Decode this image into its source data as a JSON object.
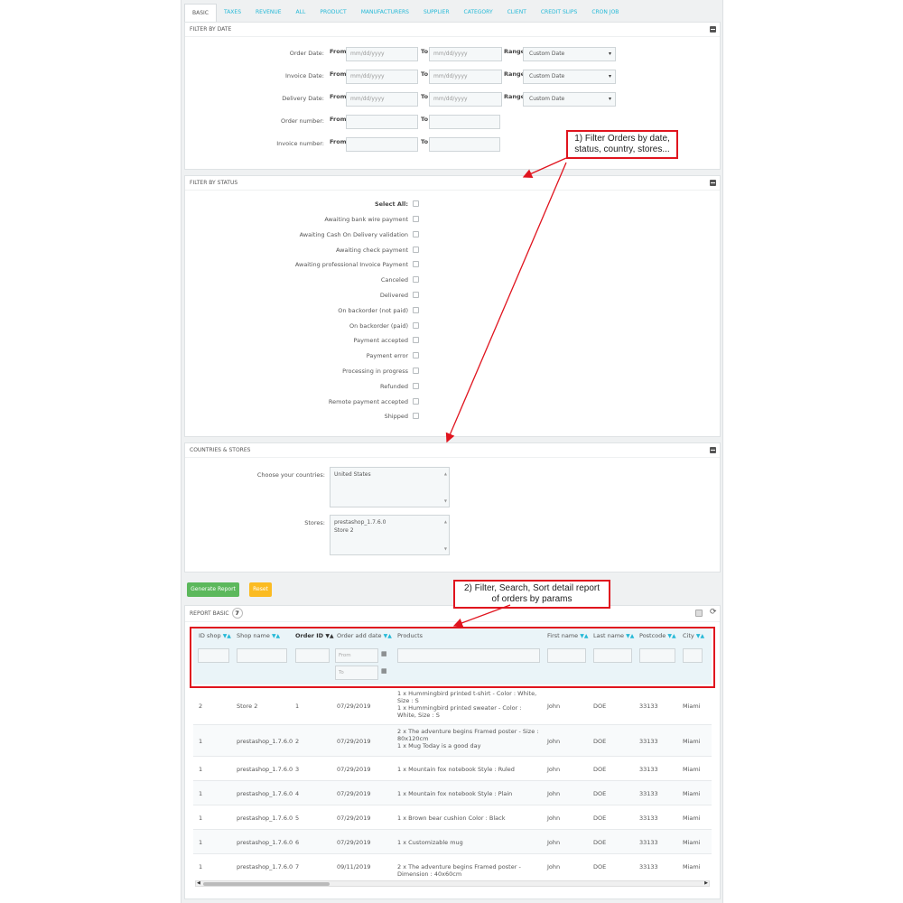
{
  "tabs": [
    "BASIC",
    "TAXES",
    "REVENUE",
    "ALL",
    "PRODUCT",
    "MANUFACTURERS",
    "SUPPLIER",
    "CATEGORY",
    "CLIENT",
    "CREDIT SLIPS",
    "CRON JOB"
  ],
  "filter_date": {
    "title": "FILTER BY DATE",
    "from_label": "From",
    "to_label": "To",
    "range_label": "Range",
    "date_placeholder": "mm/dd/yyyy",
    "range_value": "Custom Date",
    "rows": [
      "Order Date:",
      "Invoice Date:",
      "Delivery Date:",
      "Order number:",
      "Invoice number:"
    ]
  },
  "filter_status": {
    "title": "FILTER BY STATUS",
    "select_all": "Select All:",
    "statuses": [
      "Awaiting bank wire payment",
      "Awaiting Cash On Delivery validation",
      "Awaiting check payment",
      "Awaiting professional Invoice Payment",
      "Canceled",
      "Delivered",
      "On backorder (not paid)",
      "On backorder (paid)",
      "Payment accepted",
      "Payment error",
      "Processing in progress",
      "Refunded",
      "Remote payment accepted",
      "Shipped"
    ]
  },
  "countries_stores": {
    "title": "COUNTRIES & STORES",
    "countries_label": "Choose your countries:",
    "countries": [
      "United States"
    ],
    "stores_label": "Stores:",
    "stores": [
      "prestashop_1.7.6.0",
      "Store 2"
    ]
  },
  "buttons": {
    "generate": "Generate Report",
    "reset": "Reset"
  },
  "colors": {
    "accent": "#25b9d7",
    "generate": "#5cb85c",
    "reset": "#fbbb22",
    "callout": "#e0141e"
  },
  "callouts": {
    "one": [
      "1) Filter Orders by date,",
      "status, country, stores..."
    ],
    "two": [
      "2) Filter, Search, Sort detail report",
      "of orders by params"
    ]
  },
  "report": {
    "title": "REPORT BASIC",
    "count": "7",
    "columns": [
      "ID shop",
      "Shop name",
      "Order ID",
      "Order add date",
      "Products",
      "First name",
      "Last name",
      "Postcode",
      "City"
    ],
    "from_placeholder": "From",
    "to_placeholder": "To",
    "rows": [
      {
        "id_shop": "2",
        "shop": "Store 2",
        "order_id": "1",
        "date": "07/29/2019",
        "products": "1 x Hummingbird printed t-shirt - Color : White, Size : S\n1 x Hummingbird printed sweater - Color : White, Size : S",
        "first": "John",
        "last": "DOE",
        "postcode": "33133",
        "city": "Miami"
      },
      {
        "id_shop": "1",
        "shop": "prestashop_1.7.6.0",
        "order_id": "2",
        "date": "07/29/2019",
        "products": "2 x The adventure begins Framed poster - Size : 80x120cm\n1 x Mug Today is a good day",
        "first": "John",
        "last": "DOE",
        "postcode": "33133",
        "city": "Miami"
      },
      {
        "id_shop": "1",
        "shop": "prestashop_1.7.6.0",
        "order_id": "3",
        "date": "07/29/2019",
        "products": "1 x Mountain fox notebook Style : Ruled",
        "first": "John",
        "last": "DOE",
        "postcode": "33133",
        "city": "Miami"
      },
      {
        "id_shop": "1",
        "shop": "prestashop_1.7.6.0",
        "order_id": "4",
        "date": "07/29/2019",
        "products": "1 x Mountain fox notebook Style : Plain",
        "first": "John",
        "last": "DOE",
        "postcode": "33133",
        "city": "Miami"
      },
      {
        "id_shop": "1",
        "shop": "prestashop_1.7.6.0",
        "order_id": "5",
        "date": "07/29/2019",
        "products": "1 x Brown bear cushion Color : Black",
        "first": "John",
        "last": "DOE",
        "postcode": "33133",
        "city": "Miami"
      },
      {
        "id_shop": "1",
        "shop": "prestashop_1.7.6.0",
        "order_id": "6",
        "date": "07/29/2019",
        "products": "1 x Customizable mug",
        "first": "John",
        "last": "DOE",
        "postcode": "33133",
        "city": "Miami"
      },
      {
        "id_shop": "1",
        "shop": "prestashop_1.7.6.0",
        "order_id": "7",
        "date": "09/11/2019",
        "products": "2 x The adventure begins Framed poster - Dimension : 40x60cm",
        "first": "John",
        "last": "DOE",
        "postcode": "33133",
        "city": "Miami"
      }
    ]
  }
}
